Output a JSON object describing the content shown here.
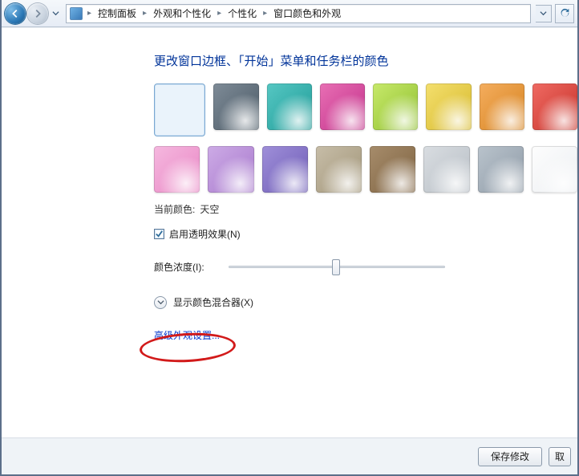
{
  "breadcrumb": {
    "items": [
      "控制面板",
      "外观和个性化",
      "个性化",
      "窗口颜色和外观"
    ]
  },
  "page": {
    "title": "更改窗口边框、「开始」菜单和任务栏的颜色"
  },
  "colors": {
    "row1": [
      {
        "name": "sky",
        "css": "linear-gradient(135deg,#d9ecfb,#9cc8ea)"
      },
      {
        "name": "slate",
        "css": "linear-gradient(135deg,#7e8b97,#4a5965)"
      },
      {
        "name": "teal",
        "css": "linear-gradient(135deg,#56c7c3,#1e9b97)"
      },
      {
        "name": "magenta",
        "css": "linear-gradient(135deg,#e86fb4,#c2308a)"
      },
      {
        "name": "lime",
        "css": "linear-gradient(135deg,#c7e96b,#8fbf2e)"
      },
      {
        "name": "gold",
        "css": "linear-gradient(135deg,#f4df6e,#d6b92c)"
      },
      {
        "name": "orange",
        "css": "linear-gradient(135deg,#f4ad5e,#d6831f)"
      },
      {
        "name": "red",
        "css": "linear-gradient(135deg,#ef6a63,#c63128)"
      }
    ],
    "row2": [
      {
        "name": "pink",
        "css": "linear-gradient(135deg,#f5b8df,#e986c4)"
      },
      {
        "name": "lavender",
        "css": "linear-gradient(135deg,#cdabe6,#a778cc)"
      },
      {
        "name": "violet",
        "css": "linear-gradient(135deg,#9f8fd9,#6d5bb5)"
      },
      {
        "name": "taupe",
        "css": "linear-gradient(135deg,#c7bda8,#a19578)"
      },
      {
        "name": "brown",
        "css": "linear-gradient(135deg,#a68c6b,#7e6240)"
      },
      {
        "name": "silver",
        "css": "linear-gradient(135deg,#d9dde1,#b7bec5)"
      },
      {
        "name": "steel",
        "css": "linear-gradient(135deg,#b9c3cc,#8e9aa6)"
      },
      {
        "name": "white",
        "css": "linear-gradient(135deg,#fdfdfd,#eceff2)"
      }
    ]
  },
  "current_color": {
    "label": "当前颜色:",
    "value": "天空"
  },
  "transparency": {
    "label": "启用透明效果(N)",
    "checked": true
  },
  "intensity": {
    "label": "颜色浓度(I):",
    "value_pct": 48
  },
  "mixer": {
    "label": "显示颜色混合器(X)"
  },
  "advanced_link": {
    "label": "高级外观设置..."
  },
  "buttons": {
    "save": "保存修改",
    "cancel": "取"
  }
}
